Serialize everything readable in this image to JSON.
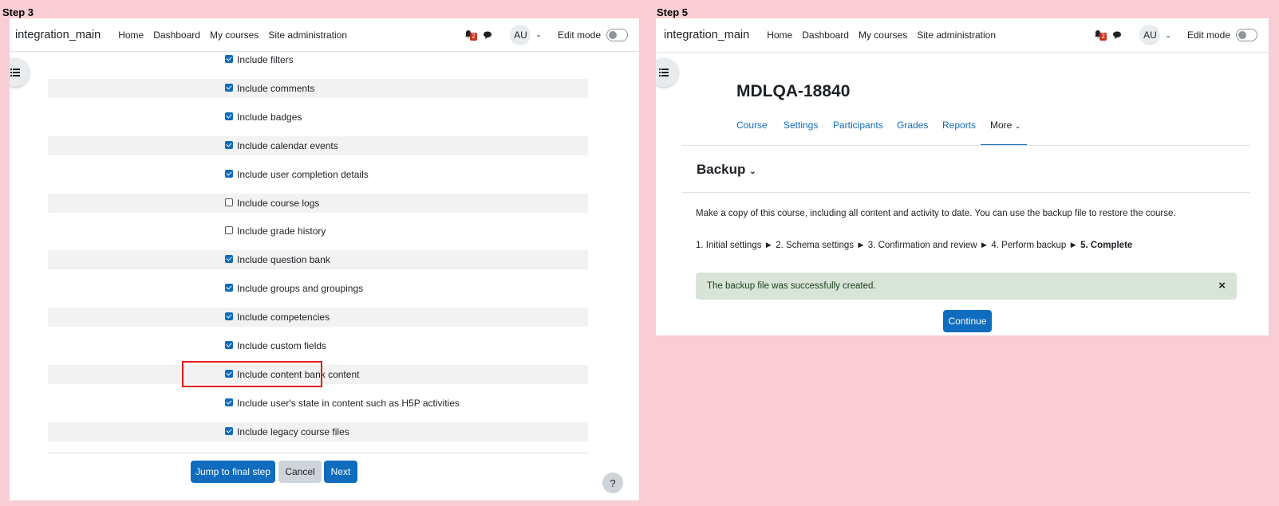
{
  "step3": {
    "label": "Step 3",
    "navbar": {
      "brand": "integration_main",
      "links": [
        "Home",
        "Dashboard",
        "My courses",
        "Site administration"
      ],
      "notification_count": "2",
      "avatar_initials": "AU",
      "edit_mode_label": "Edit mode"
    },
    "options": [
      {
        "label": "Include filters",
        "checked": true
      },
      {
        "label": "Include comments",
        "checked": true
      },
      {
        "label": "Include badges",
        "checked": true
      },
      {
        "label": "Include calendar events",
        "checked": true
      },
      {
        "label": "Include user completion details",
        "checked": true
      },
      {
        "label": "Include course logs",
        "checked": false
      },
      {
        "label": "Include grade history",
        "checked": false
      },
      {
        "label": "Include question bank",
        "checked": true
      },
      {
        "label": "Include groups and groupings",
        "checked": true
      },
      {
        "label": "Include competencies",
        "checked": true
      },
      {
        "label": "Include custom fields",
        "checked": true
      },
      {
        "label": "Include content bank content",
        "checked": true
      },
      {
        "label": "Include user's state in content such as H5P activities",
        "checked": true
      },
      {
        "label": "Include legacy course files",
        "checked": true
      }
    ],
    "buttons": {
      "jump": "Jump to final step",
      "cancel": "Cancel",
      "next": "Next"
    },
    "help_label": "?"
  },
  "step5": {
    "label": "Step 5",
    "navbar": {
      "brand": "integration_main",
      "links": [
        "Home",
        "Dashboard",
        "My courses",
        "Site administration"
      ],
      "notification_count": "2",
      "avatar_initials": "AU",
      "edit_mode_label": "Edit mode"
    },
    "course_title": "MDLQA-18840",
    "tabs": [
      "Course",
      "Settings",
      "Participants",
      "Grades",
      "Reports",
      "More"
    ],
    "active_tab": "More",
    "section_title": "Backup",
    "description": "Make a copy of this course, including all content and activity to date. You can use the backup file to restore the course.",
    "progress": {
      "steps": "1. Initial settings ► 2. Schema settings ► 3. Confirmation and review ► 4. Perform backup ► ",
      "current": "5. Complete"
    },
    "alert": "The backup file was successfully created.",
    "continue_label": "Continue"
  },
  "colors": {
    "background": "#f8cdd3",
    "primary": "#0f6cbf",
    "highlight": "#e41b1b",
    "success_bg": "#d7e4d7"
  }
}
